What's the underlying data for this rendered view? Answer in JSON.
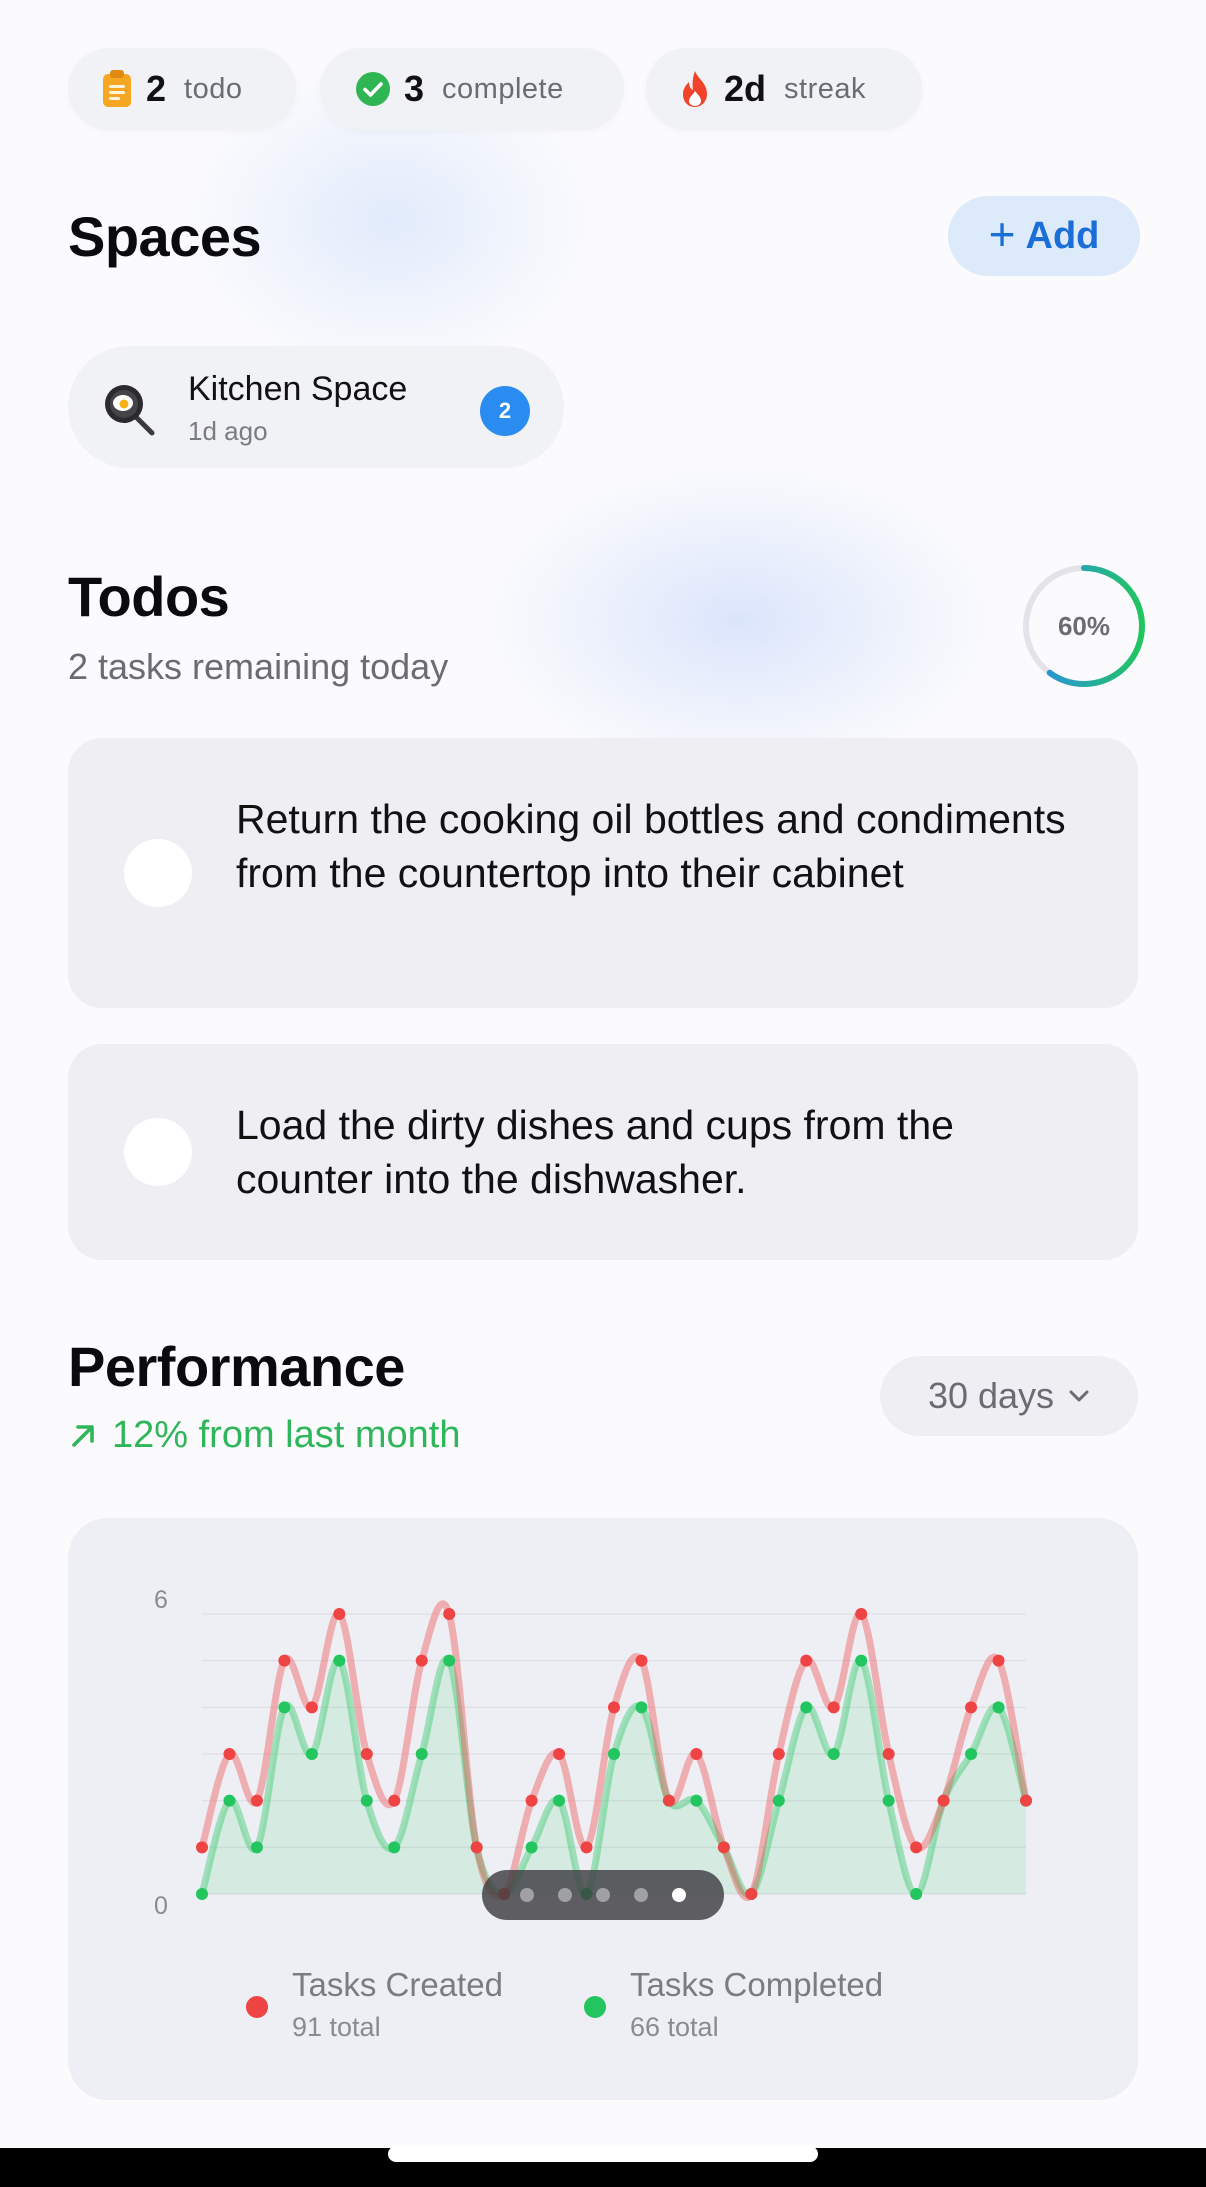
{
  "stats": [
    {
      "icon": "clipboard-icon",
      "value": "2",
      "label": "todo"
    },
    {
      "icon": "checkmark-circle-icon",
      "value": "3",
      "label": "complete"
    },
    {
      "icon": "flame-icon",
      "value": "2d",
      "label": "streak"
    }
  ],
  "spaces": {
    "title": "Spaces",
    "add_label": "Add",
    "items": [
      {
        "icon": "frying-pan-icon",
        "name": "Kitchen Space",
        "time": "1d ago",
        "badge": "2"
      }
    ]
  },
  "todos": {
    "title": "Todos",
    "subtitle": "2 tasks remaining today",
    "progress_label": "60%",
    "progress_fraction": 0.6,
    "items": [
      {
        "text": "Return the cooking oil bottles and condiments from the countertop into their cabinet",
        "checked": false
      },
      {
        "text": "Load the dirty dishes and cups from the counter into the dishwasher.",
        "checked": false
      }
    ]
  },
  "performance": {
    "title": "Performance",
    "trend": "12% from last month",
    "range": "30 days",
    "pager": {
      "count": 5,
      "active": 4
    },
    "legend": [
      {
        "name": "Tasks Created",
        "total": "91 total",
        "color": "#ef4444"
      },
      {
        "name": "Tasks Completed",
        "total": "66 total",
        "color": "#22c55e"
      }
    ]
  },
  "colors": {
    "accent": "#1a6ed8",
    "created": "#ef4444",
    "completed": "#22c55e",
    "trend": "#30b65a",
    "ring_start": "#2a8cf0",
    "ring_end": "#22c55e"
  },
  "chart_data": {
    "type": "line",
    "ylim": [
      0,
      6
    ],
    "yticks": [
      "6",
      "0"
    ],
    "series": [
      {
        "name": "Tasks Created",
        "color": "#ef4444",
        "values": [
          1,
          3,
          2,
          5,
          4,
          6,
          3,
          2,
          5,
          6,
          1,
          0,
          2,
          3,
          1,
          4,
          5,
          2,
          3,
          1,
          0,
          3,
          5,
          4,
          6,
          3,
          1,
          2,
          4,
          5,
          2
        ]
      },
      {
        "name": "Tasks Completed",
        "color": "#22c55e",
        "values": [
          0,
          2,
          1,
          4,
          3,
          5,
          2,
          1,
          3,
          5,
          1,
          0,
          1,
          2,
          0,
          3,
          4,
          2,
          2,
          1,
          0,
          2,
          4,
          3,
          5,
          2,
          0,
          2,
          3,
          4,
          2
        ]
      }
    ]
  }
}
